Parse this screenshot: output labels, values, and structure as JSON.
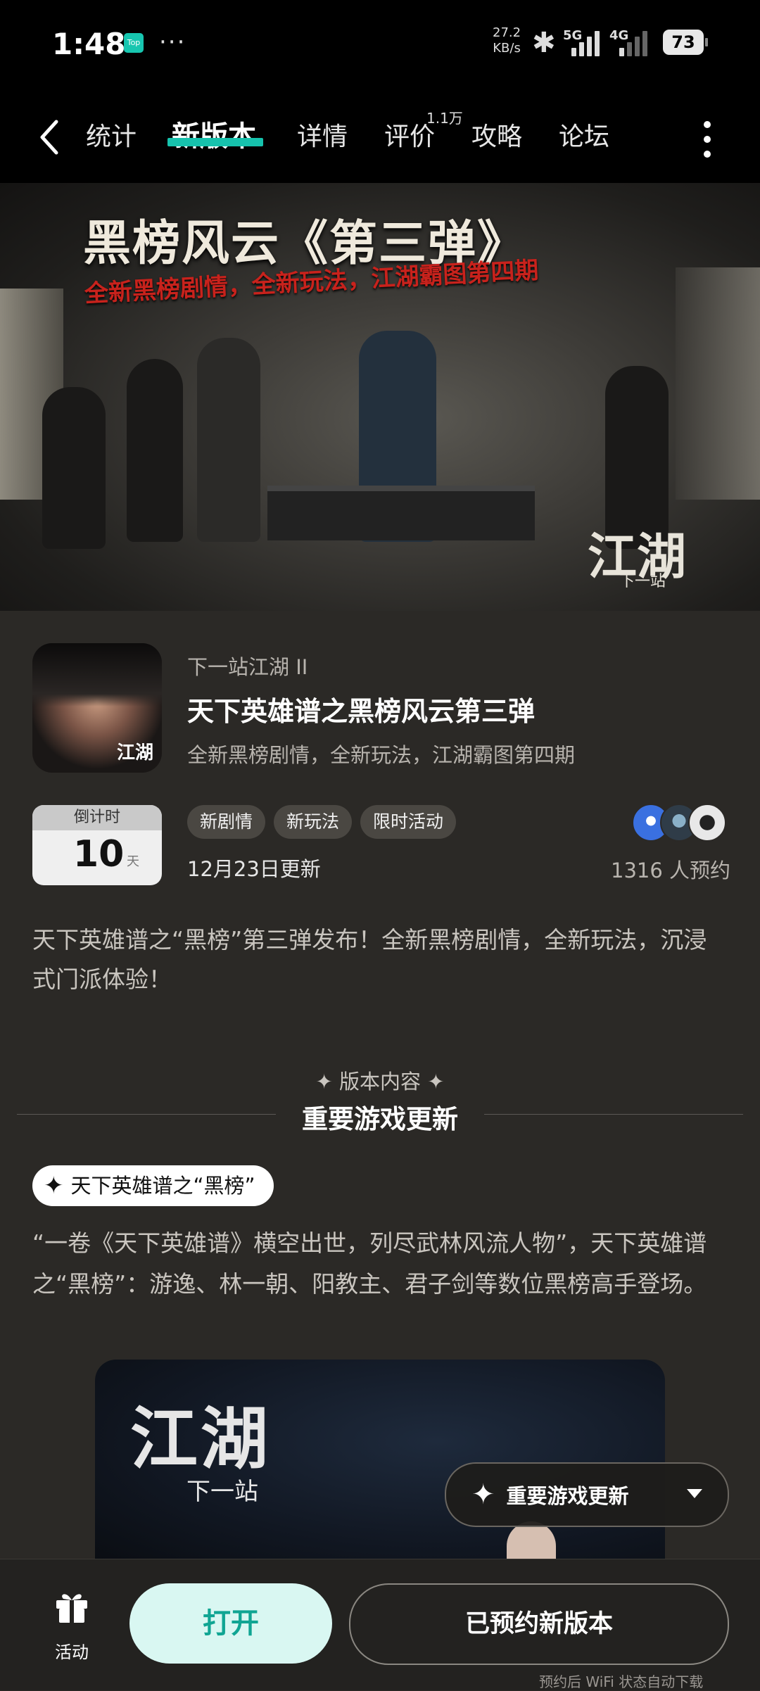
{
  "status_bar": {
    "time": "1:48",
    "app_badge": "Top",
    "overflow": "···",
    "net_speed_value": "27.2",
    "net_speed_unit": "KB/s",
    "signal_5g": "5G",
    "signal_4g": "4G",
    "battery": "73"
  },
  "nav": {
    "tabs": [
      {
        "label": "统计"
      },
      {
        "label": "新版本"
      },
      {
        "label": "详情"
      },
      {
        "label": "评价"
      },
      {
        "label": "攻略"
      },
      {
        "label": "论坛"
      }
    ],
    "review_count": "1.1万",
    "active_tab": "新版本"
  },
  "banner": {
    "title": "黑榜风云《第三弹》",
    "subtitle": "全新黑榜剧情，全新玩法，江湖霸图第四期",
    "logo": "江湖",
    "logo_sub": "下一站"
  },
  "app": {
    "game_name": "下一站江湖 II",
    "version_title": "天下英雄谱之黑榜风云第三弹",
    "version_sub": "全新黑榜剧情，全新玩法，江湖霸图第四期",
    "icon_logo": "江湖"
  },
  "countdown": {
    "label": "倒计时",
    "value": "10",
    "unit": "天"
  },
  "tags": [
    "新剧情",
    "新玩法",
    "限时活动"
  ],
  "update_date": "12月23日更新",
  "reserve_count": "1316 人预约",
  "description": "天下英雄谱之“黑榜”第三弹发布！全新黑榜剧情，全新玩法，沉浸式门派体验！",
  "section": {
    "label": "✦ 版本内容 ✦",
    "title": "重要游戏更新"
  },
  "content": {
    "pill": "天下英雄谱之“黑榜”",
    "text": "“一卷《天下英雄谱》横空出世，列尽武林风流人物”，天下英雄谱之“黑榜”：游逸、林一朝、阳教主、君子剑等数位黑榜高手登场。"
  },
  "preview": {
    "logo": "江湖",
    "logo_sub": "下一站"
  },
  "floating_menu": {
    "label": "重要游戏更新"
  },
  "bottom_bar": {
    "activity_label": "活动",
    "open_button": "打开",
    "reserved_button": "已预约新版本",
    "wifi_note": "预约后 WiFi 状态自动下载"
  },
  "colors": {
    "accent": "#16c2ad",
    "background": "#2b2926",
    "open_button_bg": "#d9f7f2"
  }
}
